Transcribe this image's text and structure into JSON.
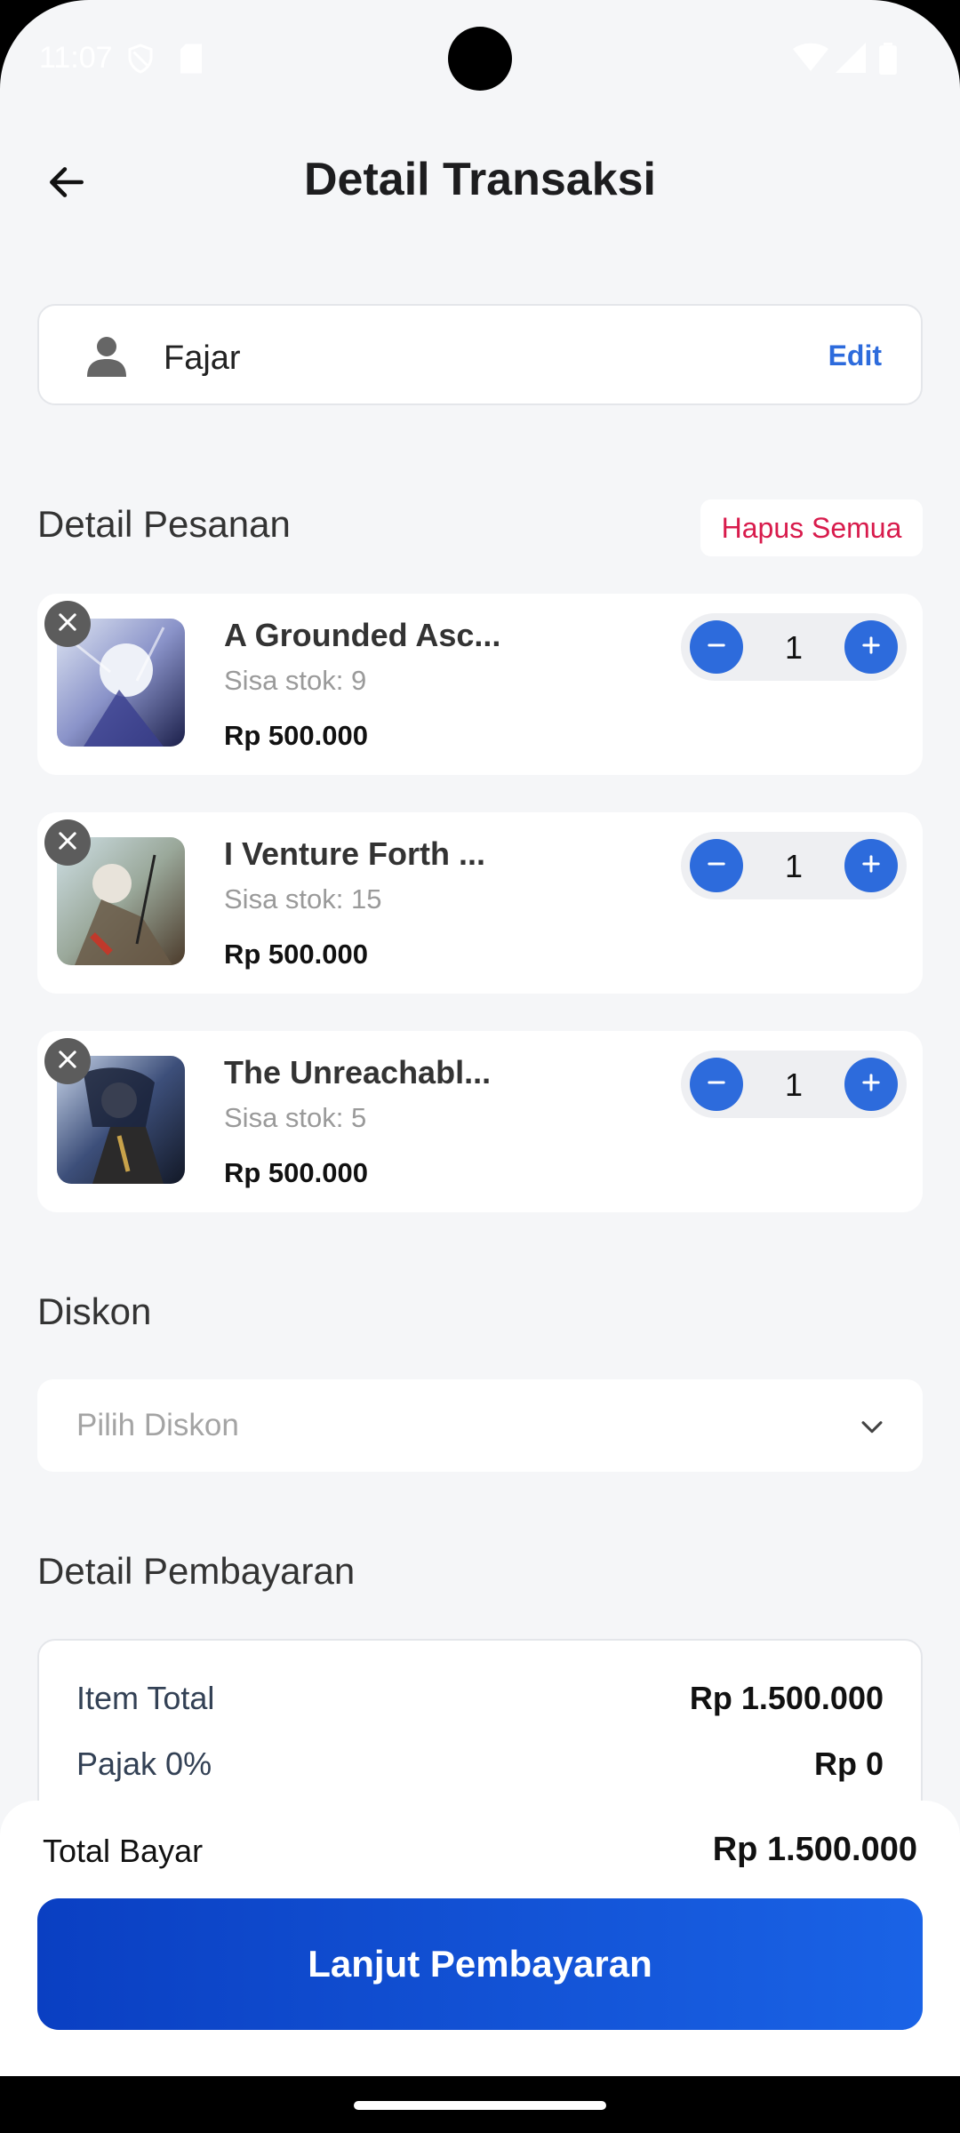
{
  "status_bar": {
    "time": "11:07"
  },
  "header": {
    "title": "Detail Transaksi"
  },
  "customer": {
    "name": "Fajar",
    "edit_label": "Edit"
  },
  "order_section": {
    "title": "Detail Pesanan",
    "clear_all_label": "Hapus Semua",
    "items": [
      {
        "title": "A Grounded Asc...",
        "stock": "Sisa stok: 9",
        "price": "Rp 500.000",
        "qty": "1"
      },
      {
        "title": "I Venture Forth ...",
        "stock": "Sisa stok: 15",
        "price": "Rp 500.000",
        "qty": "1"
      },
      {
        "title": "The Unreachabl...",
        "stock": "Sisa stok: 5",
        "price": "Rp 500.000",
        "qty": "1"
      }
    ]
  },
  "discount": {
    "title": "Diskon",
    "placeholder": "Pilih Diskon"
  },
  "payment": {
    "title": "Detail Pembayaran",
    "rows": [
      {
        "label": "Item Total",
        "value": "Rp 1.500.000"
      },
      {
        "label": "Pajak 0%",
        "value": "Rp 0"
      }
    ]
  },
  "footer": {
    "total_label": "Total Bayar",
    "total_value": "Rp 1.500.000",
    "cta_label": "Lanjut Pembayaran"
  },
  "colors": {
    "accent": "#2d6bdc",
    "danger": "#d81b4c",
    "cta_start": "#0a3fc2",
    "cta_end": "#1a63e6"
  }
}
